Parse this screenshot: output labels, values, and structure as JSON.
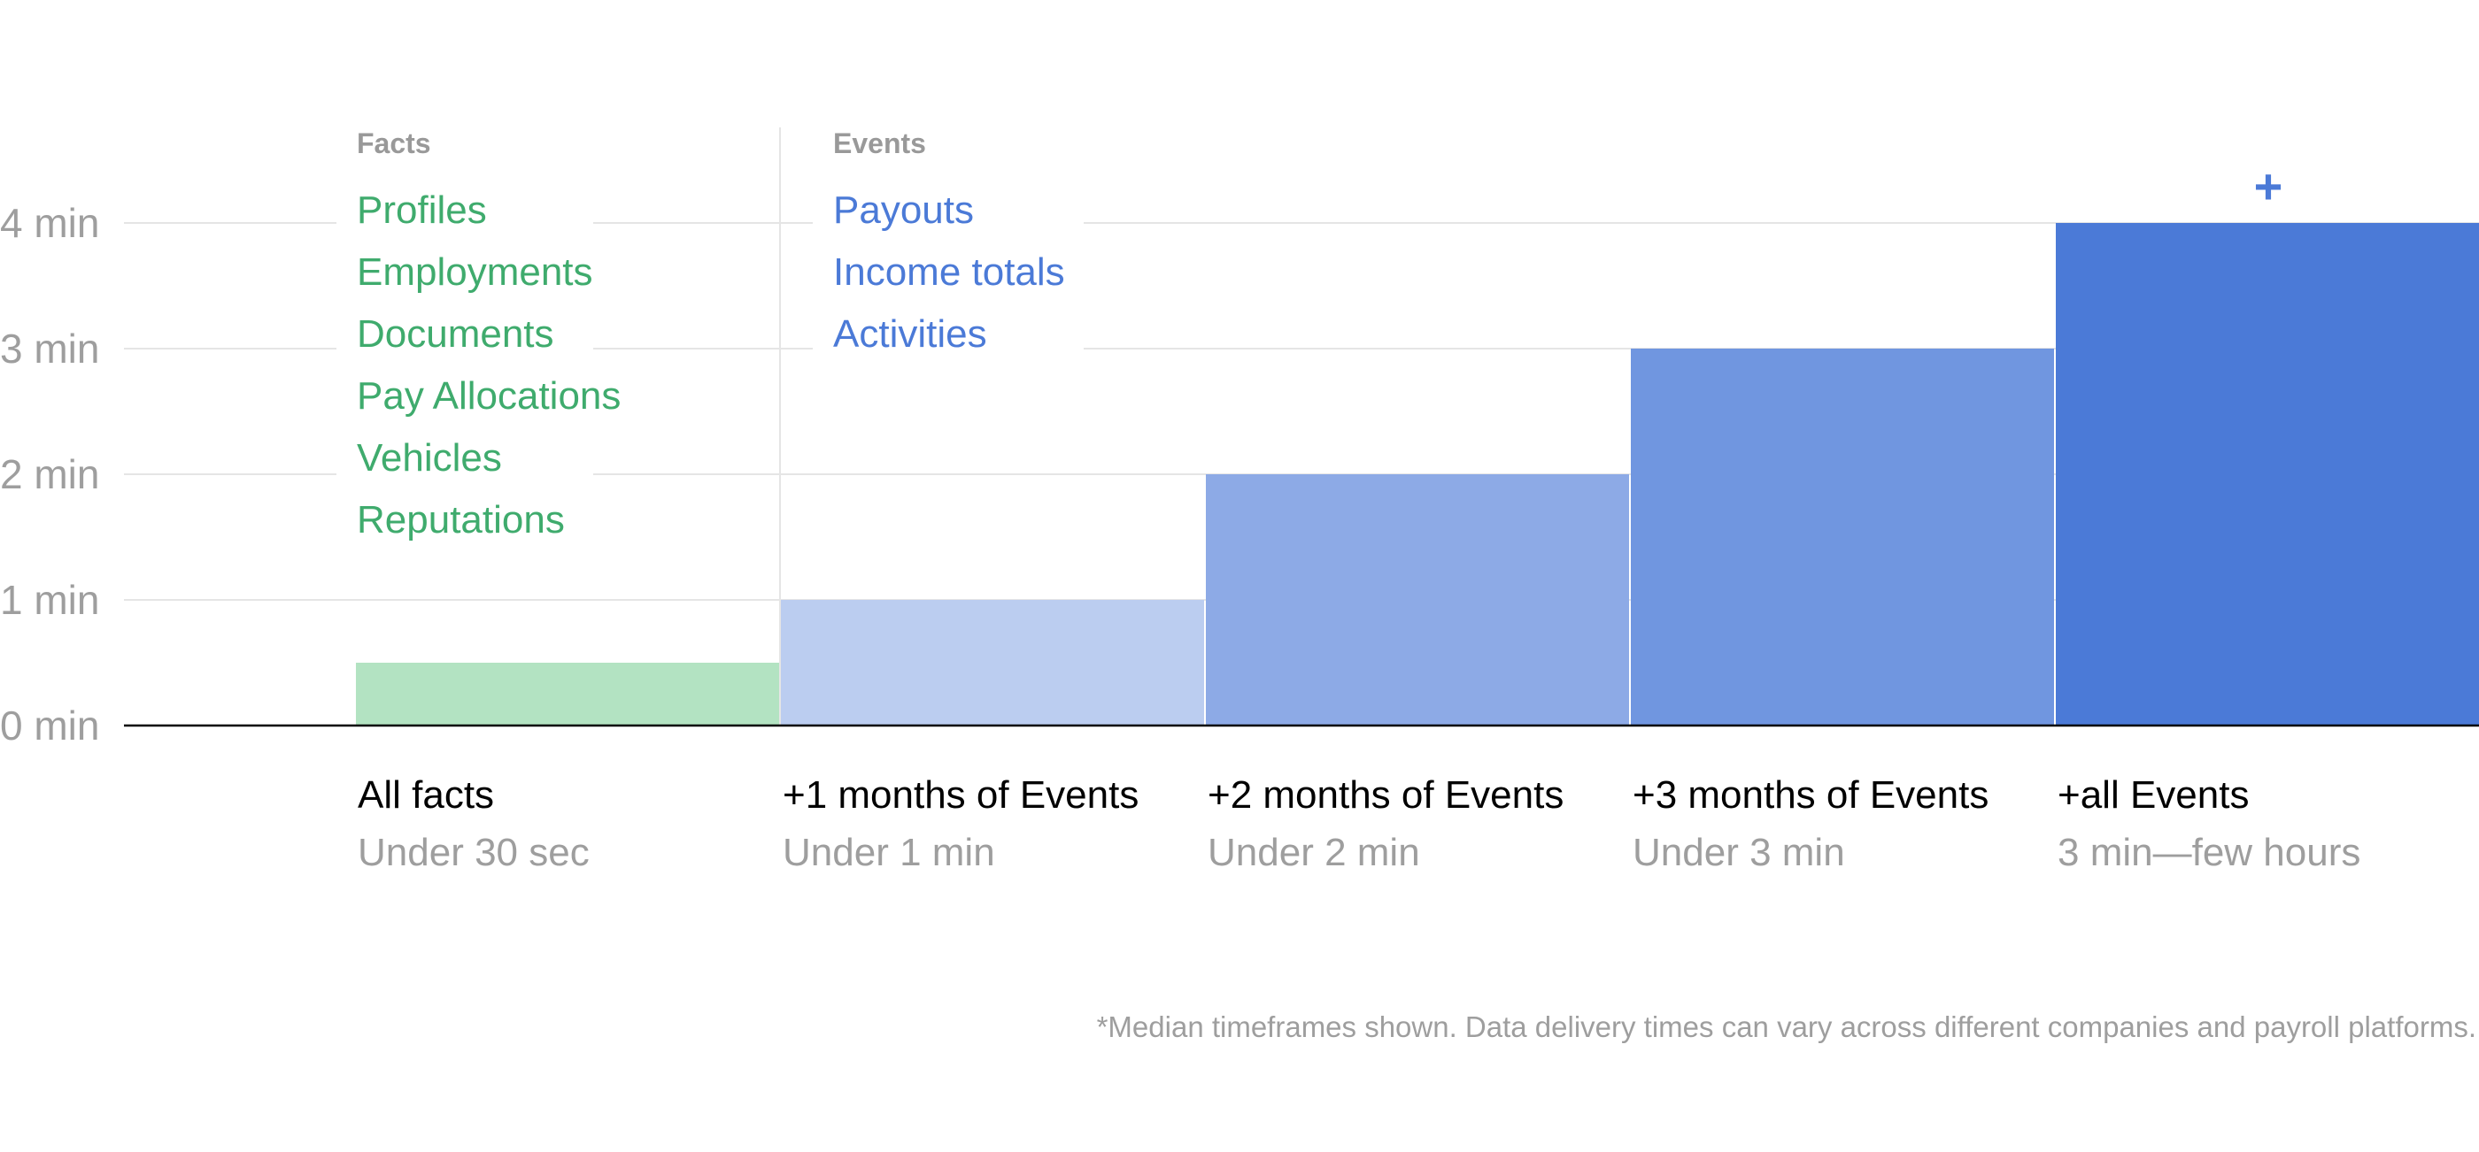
{
  "chart_data": {
    "type": "bar",
    "title": "",
    "xlabel": "",
    "ylabel": "",
    "ylim": [
      0,
      4
    ],
    "y_ticks": [
      {
        "value": 0,
        "label": "0 min"
      },
      {
        "value": 1,
        "label": "1 min"
      },
      {
        "value": 2,
        "label": "2 min"
      },
      {
        "value": 3,
        "label": "3 min"
      },
      {
        "value": 4,
        "label": "4 min"
      }
    ],
    "grid": true,
    "categories": [
      {
        "label": "All facts",
        "sublabel": "Under 30 sec",
        "value": 0.5,
        "color": "#b3e3c2"
      },
      {
        "label": "+1 months of Events",
        "sublabel": "Under 1 min",
        "value": 1,
        "color": "#bbcdf0"
      },
      {
        "label": "+2 months of Events",
        "sublabel": "Under 2 min",
        "value": 2,
        "color": "#8daae6"
      },
      {
        "label": "+3 months of Events",
        "sublabel": "Under 3 min",
        "value": 3,
        "color": "#7096e0"
      },
      {
        "label": "+all Events",
        "sublabel": "3 min—few hours",
        "value": 4,
        "color": "#4b7ad7",
        "annotation": "+"
      }
    ],
    "values": [
      0.5,
      1,
      2,
      3,
      4
    ],
    "unit": "min",
    "legend_groups": [
      {
        "header": "Facts",
        "color": "#3fab6d",
        "items": [
          "Profiles",
          "Employments",
          "Documents",
          "Pay Allocations",
          "Vehicles",
          "Reputations"
        ]
      },
      {
        "header": "Events",
        "color": "#4b7ad7",
        "items": [
          "Payouts",
          "Income totals",
          "Activities"
        ]
      }
    ],
    "footnote": "*Median timeframes shown. Data delivery times can vary across different companies and payroll platforms."
  }
}
